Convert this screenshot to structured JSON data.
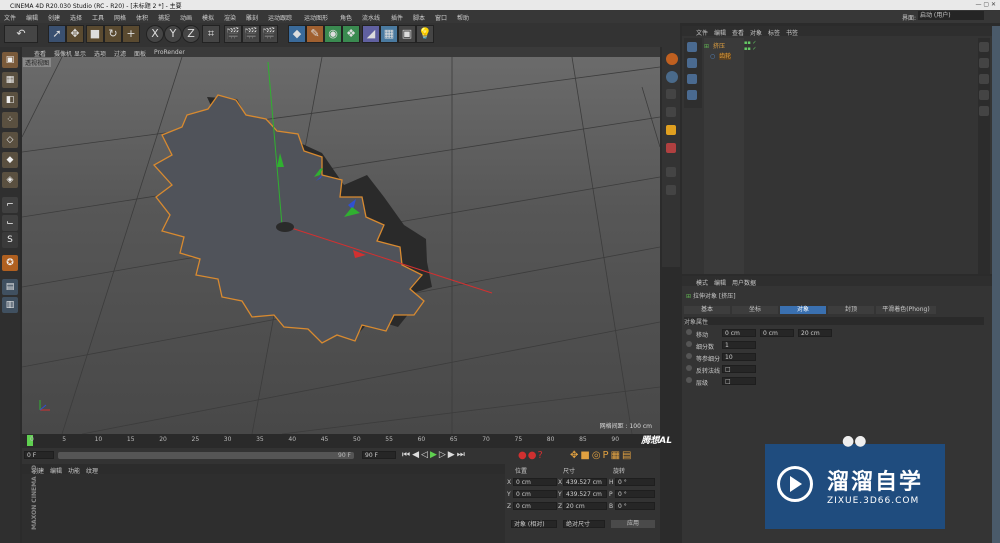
{
  "window": {
    "title": "CINEMA 4D R20.030 Studio (RC - R20) - [未标题 2 *] - 主要",
    "interface_label": "界面:",
    "interface_value": "启动 (用户)"
  },
  "menu": [
    "文件",
    "编辑",
    "创建",
    "选择",
    "工具",
    "网格",
    "体积",
    "捕捉",
    "动画",
    "模拟",
    "渲染",
    "雕刻",
    "运动跟踪",
    "运动图形",
    "角色",
    "流水线",
    "插件",
    "脚本",
    "窗口",
    "帮助"
  ],
  "viewport": {
    "menu": [
      "查看",
      "摄像机",
      "显示",
      "选项",
      "过滤",
      "面板",
      "ProRender"
    ],
    "label": "透视视图",
    "grid_spacing": "网格间距 : 100 cm"
  },
  "objects": {
    "menu": [
      "文件",
      "编辑",
      "查看",
      "对象",
      "标签",
      "书签"
    ],
    "items": [
      {
        "name": "挤压"
      },
      {
        "name": "齿轮"
      }
    ]
  },
  "attributes": {
    "menu": [
      "模式",
      "编辑",
      "用户数据"
    ],
    "object_title": "拉伸对象 [挤压]",
    "tabs": [
      "基本",
      "坐标",
      "对象",
      "封顶",
      "平滑着色(Phong)"
    ],
    "active_tab": "对象",
    "section": "对象属性",
    "fields": [
      {
        "label": "移动",
        "values": [
          "0 cm",
          "0 cm",
          "20 cm"
        ]
      },
      {
        "label": "细分数",
        "values": [
          "1"
        ]
      },
      {
        "label": "等参细分",
        "values": [
          "10"
        ]
      },
      {
        "label": "反转法线",
        "values": [
          "□"
        ]
      },
      {
        "label": "层级",
        "values": [
          "□"
        ]
      }
    ]
  },
  "timeline": {
    "ticks": [
      "0",
      "5",
      "10",
      "15",
      "20",
      "25",
      "30",
      "35",
      "40",
      "45",
      "50",
      "55",
      "60",
      "65",
      "70",
      "75",
      "80",
      "85",
      "90"
    ],
    "start": "0 F",
    "end": "90 F",
    "end2": "90 F",
    "current": "0 F",
    "brand": "腾想AL"
  },
  "bottom": {
    "tabs": [
      "创建",
      "编辑",
      "功能",
      "纹理"
    ]
  },
  "coords": {
    "headers": [
      "位置",
      "尺寸",
      "旋转"
    ],
    "rows": [
      {
        "axis": "X",
        "pos": "0 cm",
        "size": "439.527 cm",
        "rot_axis": "H",
        "rot": "0 °"
      },
      {
        "axis": "Y",
        "pos": "0 cm",
        "size": "439.527 cm",
        "rot_axis": "P",
        "rot": "0 °"
      },
      {
        "axis": "Z",
        "pos": "0 cm",
        "size": "20 cm",
        "rot_axis": "B",
        "rot": "0 °"
      }
    ],
    "mode": "对象 (相对)",
    "size_mode": "绝对尺寸",
    "apply": "应用"
  },
  "watermark": {
    "title": "溜溜自学",
    "url": "ZIXUE.3D66.COM"
  },
  "colors": {
    "accent": "#f0a030",
    "gear_outline": "#d88a30",
    "axis_x": "#d23030",
    "axis_y": "#30b030",
    "axis_z": "#3050d0",
    "watermark_bg": "#1f4c7e"
  }
}
